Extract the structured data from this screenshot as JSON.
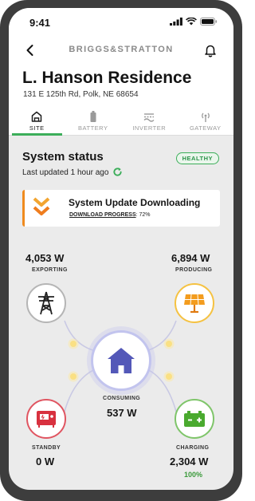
{
  "status_bar": {
    "time": "9:41"
  },
  "nav": {
    "brand": "BRIGGS&STRATTON"
  },
  "site": {
    "name": "L. Hanson Residence",
    "address": "131 E 125th Rd, Polk, NE 68654"
  },
  "tabs": [
    {
      "label": "SITE",
      "icon": "house-icon",
      "active": true
    },
    {
      "label": "BATTERY",
      "icon": "battery-icon",
      "active": false
    },
    {
      "label": "INVERTER",
      "icon": "inverter-icon",
      "active": false
    },
    {
      "label": "GATEWAY",
      "icon": "gateway-icon",
      "active": false
    }
  ],
  "system": {
    "title": "System status",
    "badge": "HEALTHY",
    "updated": "Last updated 1 hour ago"
  },
  "update_card": {
    "title": "System Update Downloading",
    "progress_label": "DOWNLOAD PROGRESS",
    "progress_value": ": 72%",
    "progress": 72
  },
  "energy": {
    "grid": {
      "value": "4,053 W",
      "label": "EXPORTING"
    },
    "solar": {
      "value": "6,894 W",
      "label": "PRODUCING"
    },
    "home": {
      "value": "537 W",
      "label": "CONSUMING"
    },
    "generator": {
      "value": "0 W",
      "label": "STANDBY"
    },
    "battery": {
      "value": "2,304 W",
      "label": "CHARGING",
      "charge": "100%"
    }
  },
  "colors": {
    "accent_green": "#3cae5a",
    "warning_orange": "#ef8a1e",
    "home_blue": "#5358b8",
    "solar_yellow": "#f5c242",
    "generator_red": "#d8313f",
    "battery_green": "#4aaa2f"
  }
}
